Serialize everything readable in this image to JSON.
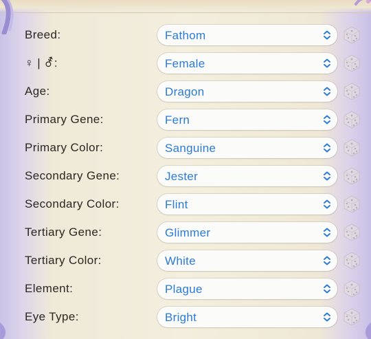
{
  "fields": [
    {
      "label": "Breed:",
      "value": "Fathom"
    },
    {
      "label": "♀ | ⚦:",
      "value": "Female"
    },
    {
      "label": "Age:",
      "value": "Dragon"
    },
    {
      "label": "Primary Gene:",
      "value": "Fern"
    },
    {
      "label": "Primary Color:",
      "value": "Sanguine"
    },
    {
      "label": "Secondary Gene:",
      "value": "Jester"
    },
    {
      "label": "Secondary Color:",
      "value": "Flint"
    },
    {
      "label": "Tertiary Gene:",
      "value": "Glimmer"
    },
    {
      "label": "Tertiary Color:",
      "value": "White"
    },
    {
      "label": "Element:",
      "value": "Plague"
    },
    {
      "label": "Eye Type:",
      "value": "Bright"
    }
  ],
  "icons": {
    "dropdown": "chevron-up-down-icon",
    "randomize": "dice-icon"
  },
  "colors": {
    "value_text": "#2a7bd8",
    "label_text": "#2c2622",
    "parchment": "#f3eedd"
  }
}
